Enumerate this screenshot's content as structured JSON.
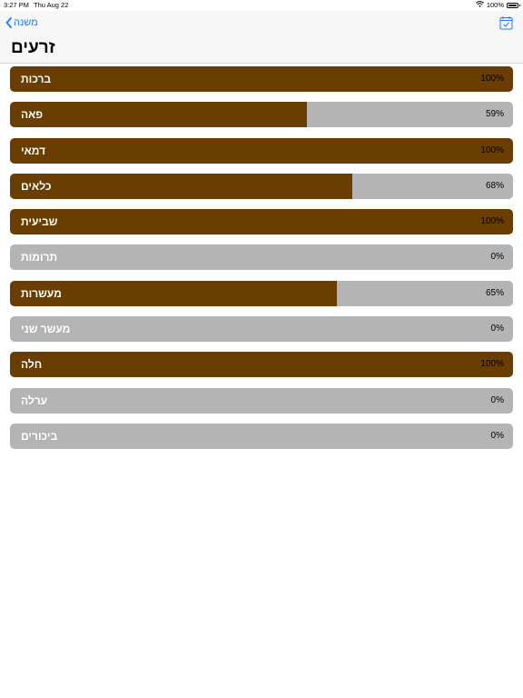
{
  "status": {
    "time": "3:27 PM",
    "date": "Thu Aug 22",
    "battery": "100%",
    "battery_level": 1.0
  },
  "nav": {
    "back_label": "משנה",
    "title": "זרעים",
    "back_icon": "chevron-left-icon",
    "calendar_icon": "calendar-check-icon",
    "accent_color": "#1a7cff"
  },
  "colors": {
    "progress_fill": "#6a3d00",
    "progress_track": "#b4b4b4"
  },
  "items": [
    {
      "label": "ברכות",
      "percent": "100%",
      "progress": 1.0
    },
    {
      "label": "פאה",
      "percent": "59%",
      "progress": 0.59
    },
    {
      "label": "דמאי",
      "percent": "100%",
      "progress": 1.0
    },
    {
      "label": "כלאים",
      "percent": "68%",
      "progress": 0.68
    },
    {
      "label": "שביעית",
      "percent": "100%",
      "progress": 1.0
    },
    {
      "label": "תרומות",
      "percent": "0%",
      "progress": 0.0
    },
    {
      "label": "מעשרות",
      "percent": "65%",
      "progress": 0.65
    },
    {
      "label": "מעשר שני",
      "percent": "0%",
      "progress": 0.0
    },
    {
      "label": "חלה",
      "percent": "100%",
      "progress": 1.0
    },
    {
      "label": "ערלה",
      "percent": "0%",
      "progress": 0.0
    },
    {
      "label": "ביכורים",
      "percent": "0%",
      "progress": 0.0
    }
  ]
}
